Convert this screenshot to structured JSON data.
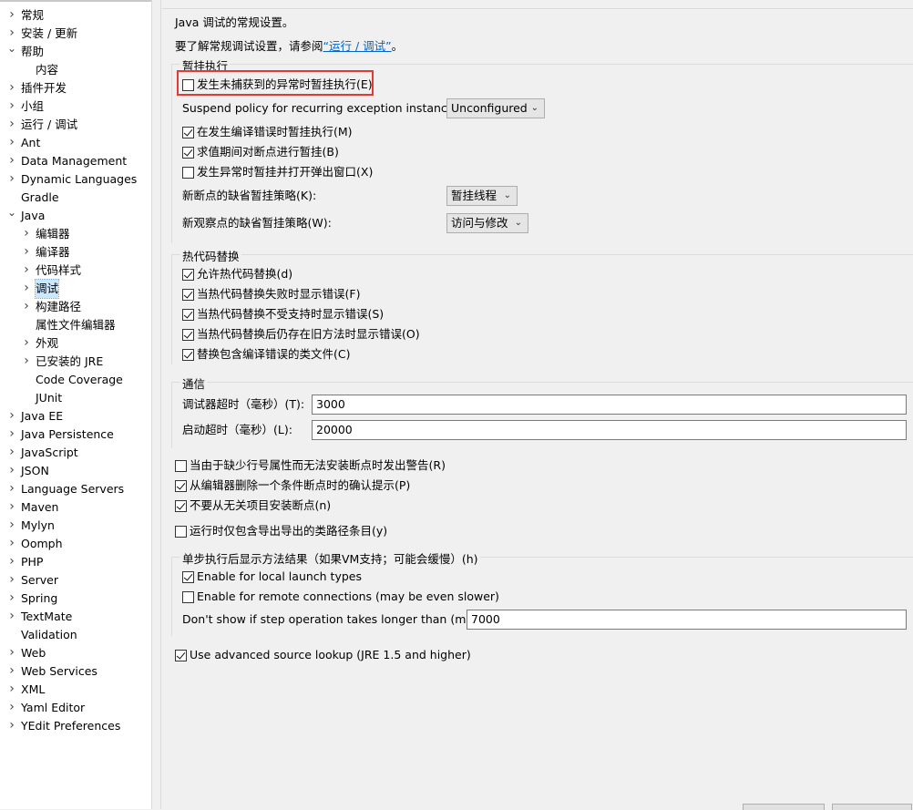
{
  "tree": {
    "items": [
      {
        "label": "常规",
        "twisty": ">"
      },
      {
        "label": "安装 / 更新",
        "twisty": ">"
      },
      {
        "label": "帮助",
        "twisty": "v"
      },
      {
        "label": "内容",
        "twisty": ""
      },
      {
        "label": "插件开发",
        "twisty": ">"
      },
      {
        "label": "小组",
        "twisty": ">"
      },
      {
        "label": "运行 / 调试",
        "twisty": ">"
      },
      {
        "label": "Ant",
        "twisty": ">"
      },
      {
        "label": "Data Management",
        "twisty": ">"
      },
      {
        "label": "Dynamic Languages",
        "twisty": ">"
      },
      {
        "label": "Gradle",
        "twisty": ""
      },
      {
        "label": "Java",
        "twisty": "v"
      },
      {
        "label": "编辑器",
        "twisty": ">"
      },
      {
        "label": "编译器",
        "twisty": ">"
      },
      {
        "label": "代码样式",
        "twisty": ">"
      },
      {
        "label": "调试",
        "twisty": ">"
      },
      {
        "label": "构建路径",
        "twisty": ">"
      },
      {
        "label": "属性文件编辑器",
        "twisty": ""
      },
      {
        "label": "外观",
        "twisty": ">"
      },
      {
        "label": "已安装的 JRE",
        "twisty": ">"
      },
      {
        "label": "Code Coverage",
        "twisty": ""
      },
      {
        "label": "JUnit",
        "twisty": ""
      },
      {
        "label": "Java EE",
        "twisty": ">"
      },
      {
        "label": "Java Persistence",
        "twisty": ">"
      },
      {
        "label": "JavaScript",
        "twisty": ">"
      },
      {
        "label": "JSON",
        "twisty": ">"
      },
      {
        "label": "Language Servers",
        "twisty": ">"
      },
      {
        "label": "Maven",
        "twisty": ">"
      },
      {
        "label": "Mylyn",
        "twisty": ">"
      },
      {
        "label": "Oomph",
        "twisty": ">"
      },
      {
        "label": "PHP",
        "twisty": ">"
      },
      {
        "label": "Server",
        "twisty": ">"
      },
      {
        "label": "Spring",
        "twisty": ">"
      },
      {
        "label": "TextMate",
        "twisty": ">"
      },
      {
        "label": "Validation",
        "twisty": ""
      },
      {
        "label": "Web",
        "twisty": ">"
      },
      {
        "label": "Web Services",
        "twisty": ">"
      },
      {
        "label": "XML",
        "twisty": ">"
      },
      {
        "label": "Yaml Editor",
        "twisty": ">"
      },
      {
        "label": "YEdit Preferences",
        "twisty": ">"
      }
    ]
  },
  "page": {
    "intro": "Java 调试的常规设置。",
    "see_prefix": "要了解常规调试设置，请参阅",
    "see_link": "“运行 / 调试”",
    "see_suffix": "。"
  },
  "suspend": {
    "title": "暂挂执行",
    "uncaught_label": "发生未捕获到的异常时暂挂执行(E)",
    "uncaught_checked": false,
    "policy_label": "Suspend policy for recurring exception instances:",
    "policy_value": "Unconfigured",
    "compile_error_label": "在发生编译错误时暂挂执行(M)",
    "compile_error_checked": true,
    "eval_label": "求值期间对断点进行暂挂(B)",
    "eval_checked": true,
    "popup_label": "发生异常时暂挂并打开弹出窗口(X)",
    "popup_checked": false,
    "bp_policy_label": "新断点的缺省暂挂策略(K):",
    "bp_policy_value": "暂挂线程",
    "wp_policy_label": "新观察点的缺省暂挂策略(W):",
    "wp_policy_value": "访问与修改"
  },
  "hotswap": {
    "title": "热代码替换",
    "items": [
      {
        "label": "允许热代码替换(d)",
        "checked": true
      },
      {
        "label": "当热代码替换失败时显示错误(F)",
        "checked": true
      },
      {
        "label": "当热代码替换不受支持时显示错误(S)",
        "checked": true
      },
      {
        "label": "当热代码替换后仍存在旧方法时显示错误(O)",
        "checked": true
      },
      {
        "label": "替换包含编译错误的类文件(C)",
        "checked": true
      }
    ]
  },
  "comm": {
    "title": "通信",
    "debugger_timeout_label": "调试器超时（毫秒）(T):",
    "debugger_timeout_value": "3000",
    "launch_timeout_label": "启动超时（毫秒）(L):",
    "launch_timeout_value": "20000"
  },
  "misc": {
    "items": [
      {
        "label": "当由于缺少行号属性而无法安装断点时发出警告(R)",
        "checked": false
      },
      {
        "label": "从编辑器删除一个条件断点时的确认提示(P)",
        "checked": true
      },
      {
        "label": "不要从无关项目安装断点(n)",
        "checked": true
      },
      {
        "label": "运行时仅包含导出导出的类路径条目(y)",
        "checked": false
      }
    ]
  },
  "step": {
    "title": "单步执行后显示方法结果（如果VM支持；可能会缓慢）(h)",
    "local_label": "Enable for local launch types",
    "local_checked": true,
    "remote_label": "Enable for remote connections (may be even slower)",
    "remote_checked": false,
    "threshold_label": "Don't show if step operation takes longer than (ms):",
    "threshold_value": "7000"
  },
  "advanced": {
    "label": "Use advanced source lookup (JRE 1.5 and higher)",
    "checked": true
  },
  "icons": {
    "collapsed": "chevron-right-icon",
    "expanded": "chevron-down-icon",
    "dropdown": "chevron-down-icon"
  },
  "colors": {
    "highlight": "#e53935",
    "link": "#0066cc",
    "selection": "#cce8ff"
  }
}
